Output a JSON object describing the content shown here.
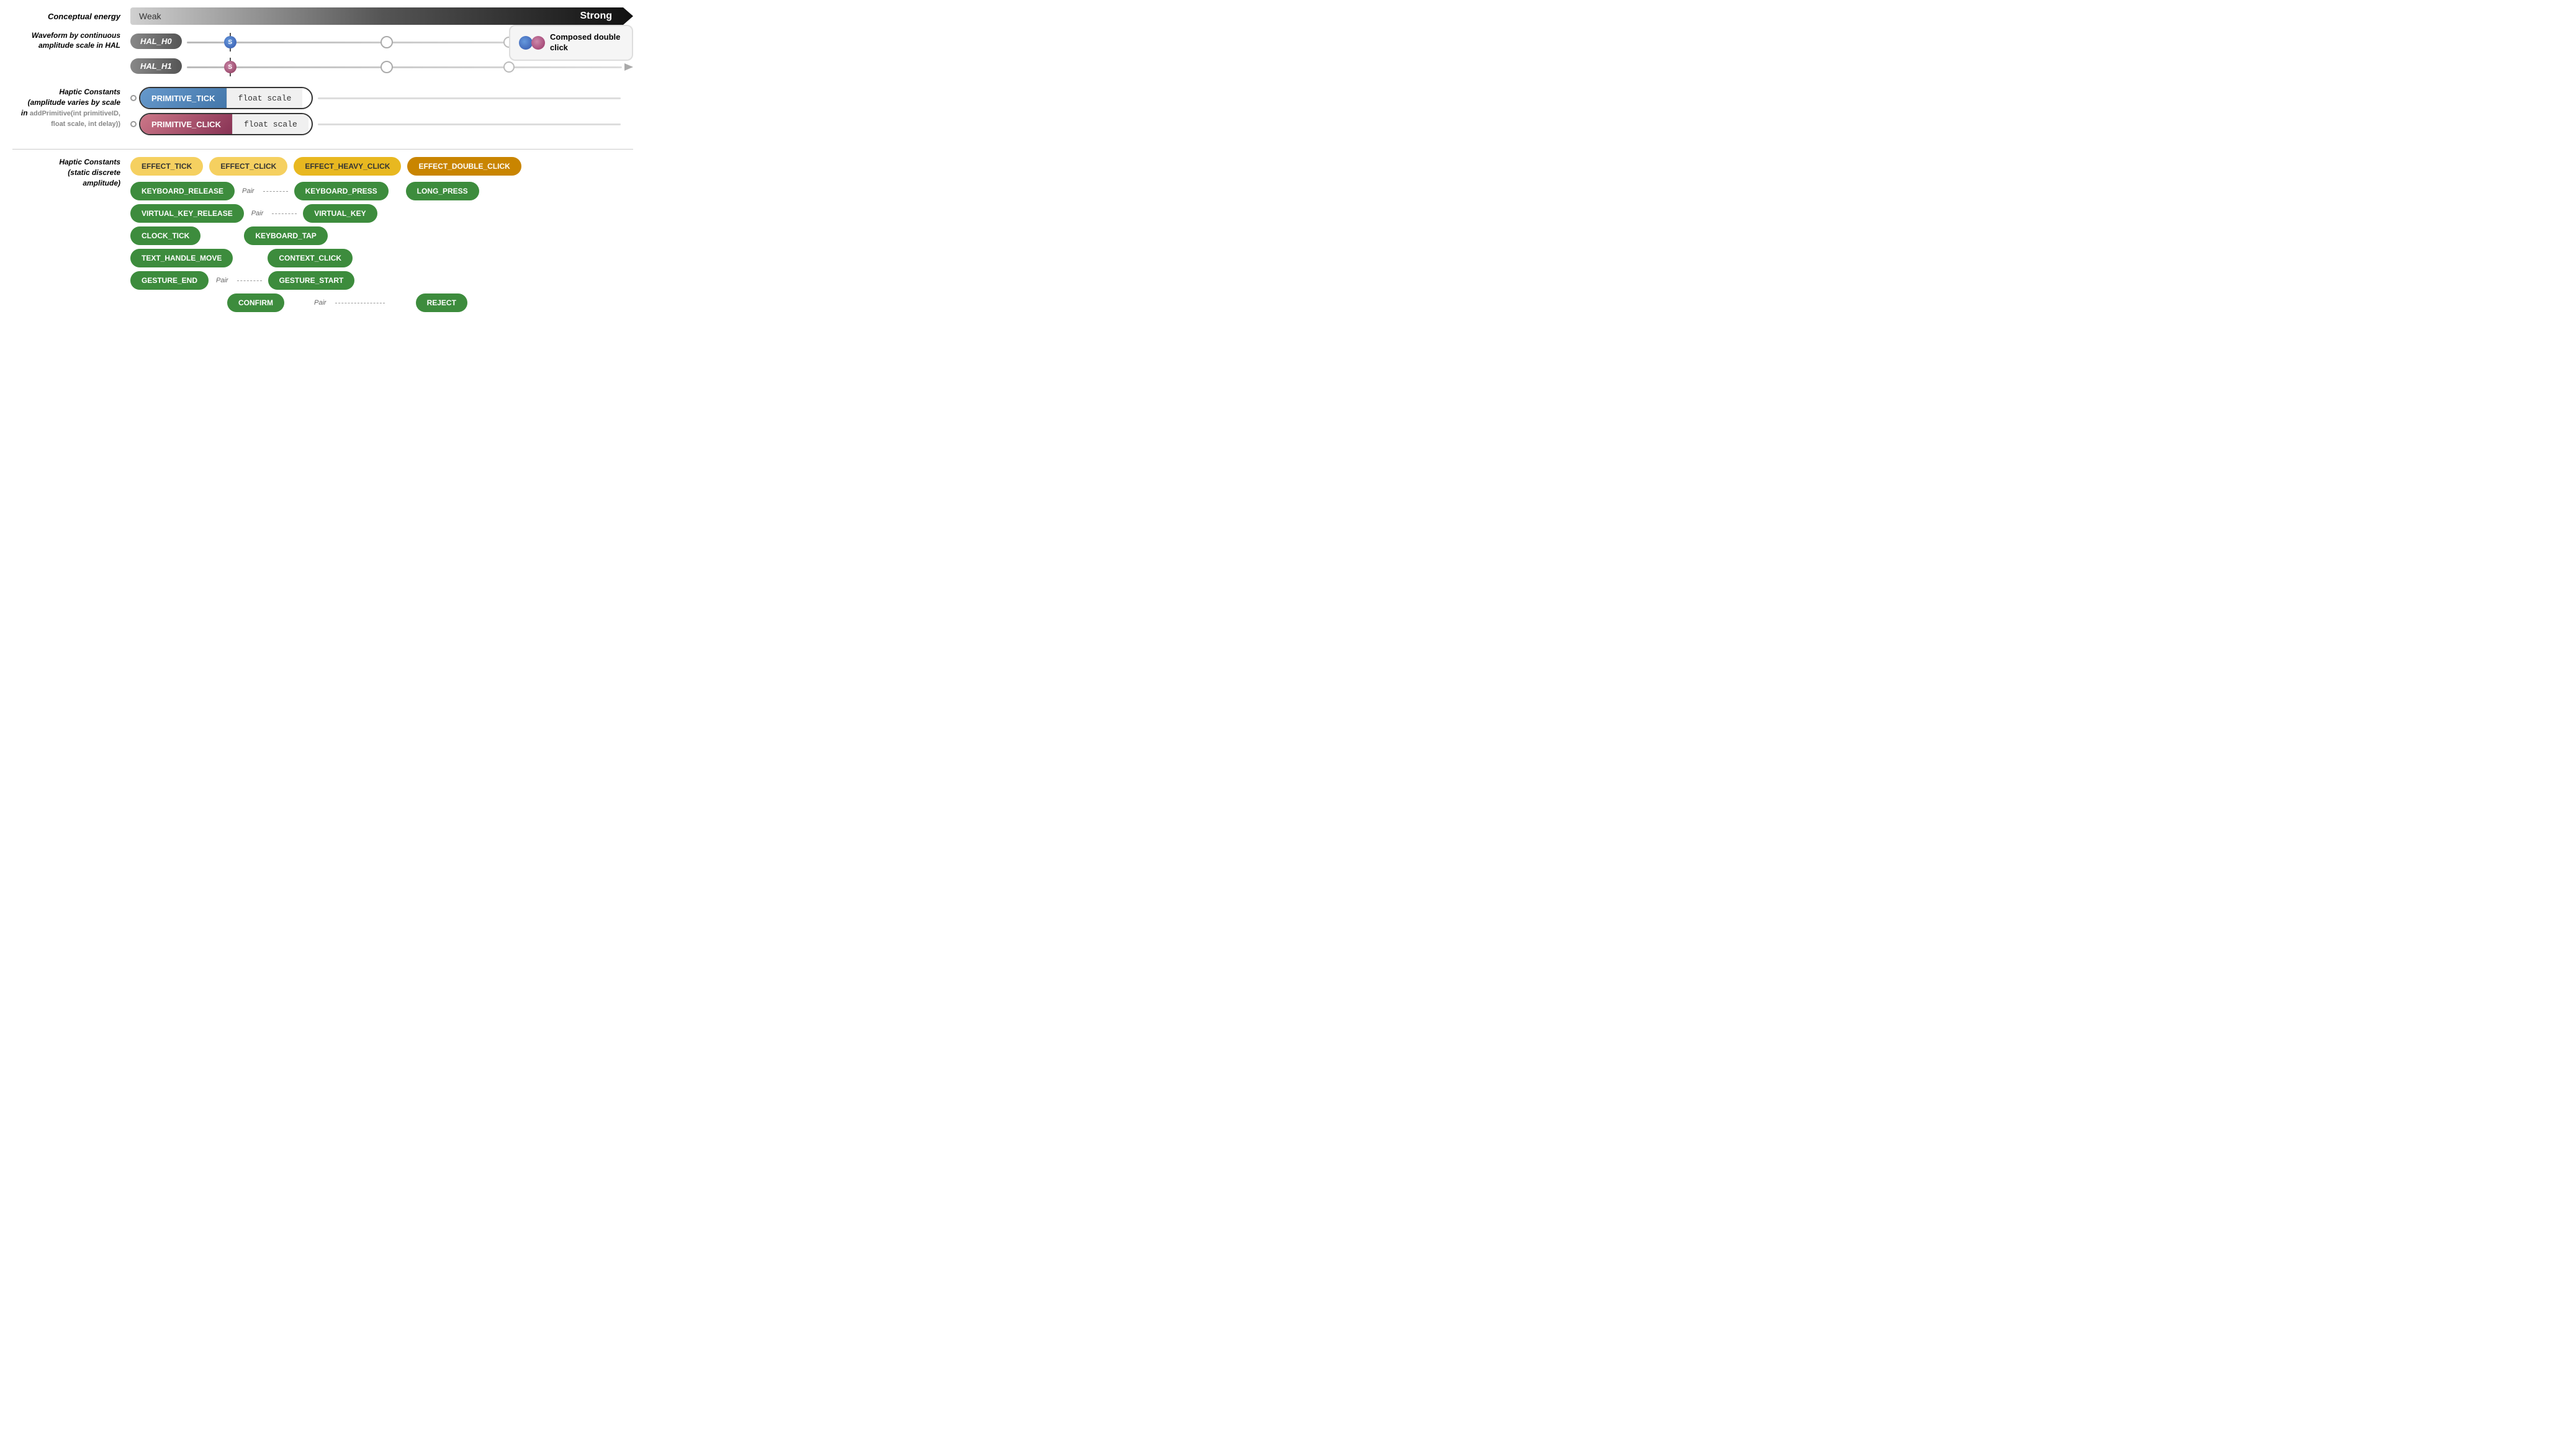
{
  "energy": {
    "label": "Conceptual energy",
    "weak": "Weak",
    "strong": "Strong"
  },
  "waveform": {
    "label": "Waveform by continuous amplitude scale in HAL"
  },
  "hal": {
    "h0_label": "HAL_H0",
    "h1_label": "HAL_H1"
  },
  "composed": {
    "title": "Composed double click"
  },
  "haptic_top": {
    "label_line1": "Haptic Constants",
    "label_line2": "(amplitude varies by scale",
    "label_line3": "in",
    "label_code": "addPrimitive(int primitiveID, float scale, int delay))",
    "tick_name": "PRIMITIVE_TICK",
    "tick_param": "float scale",
    "click_name": "PRIMITIVE_CLICK",
    "click_param": "float scale"
  },
  "effects_row1": {
    "e1": "EFFECT_TICK",
    "e2": "EFFECT_CLICK",
    "e3": "EFFECT_HEAVY_CLICK",
    "e4": "EFFECT_DOUBLE_CLICK"
  },
  "haptic_bottom": {
    "label_line1": "Haptic Constants",
    "label_line2": "(static discrete",
    "label_line3": "amplitude)"
  },
  "grid": [
    {
      "col1": "KEYBOARD_RELEASE",
      "pair1": "Pair",
      "col2": "KEYBOARD_PRESS",
      "col3": "LONG_PRESS",
      "col4": ""
    },
    {
      "col1": "VIRTUAL_KEY_RELEASE",
      "pair1": "Pair",
      "col2": "VIRTUAL_KEY",
      "col3": "",
      "col4": ""
    },
    {
      "col1": "CLOCK_TICK",
      "pair1": "",
      "col2": "KEYBOARD_TAP",
      "col3": "",
      "col4": ""
    },
    {
      "col1": "TEXT_HANDLE_MOVE",
      "pair1": "",
      "col2": "CONTEXT_CLICK",
      "col3": "",
      "col4": ""
    },
    {
      "col1": "GESTURE_END",
      "pair1": "Pair",
      "col2": "GESTURE_START",
      "col3": "",
      "col4": ""
    },
    {
      "col1": "",
      "pair1": "",
      "col2": "CONFIRM",
      "col3": "Pair",
      "col4": "REJECT"
    }
  ]
}
